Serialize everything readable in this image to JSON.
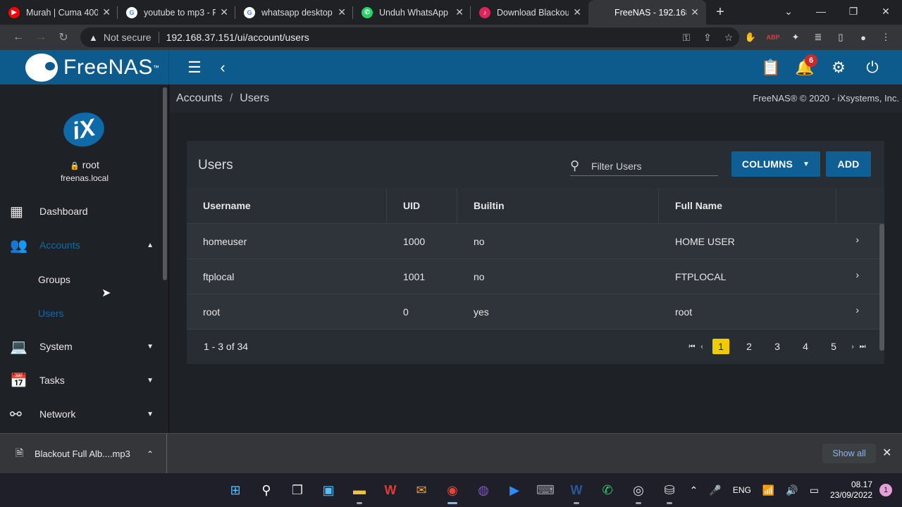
{
  "browser": {
    "tabs": [
      {
        "title": "Murah | Cuma 400",
        "favicon_color": "#ff0000",
        "favicon_glyph": "▶"
      },
      {
        "title": "youtube to mp3 - F",
        "favicon_color": "#4285f4",
        "favicon_glyph": "G"
      },
      {
        "title": "whatsapp desktop",
        "favicon_color": "#4285f4",
        "favicon_glyph": "G"
      },
      {
        "title": "Unduh WhatsApp",
        "favicon_color": "#25d366",
        "favicon_glyph": "✆"
      },
      {
        "title": "Download Blackout",
        "favicon_color": "#e0245e",
        "favicon_glyph": "♪"
      },
      {
        "title": "FreeNAS - 192.168",
        "favicon_color": "#35363a",
        "favicon_glyph": "",
        "active": true
      }
    ],
    "security_label": "Not secure",
    "url": "192.168.37.151/ui/account/users"
  },
  "freenas": {
    "brand": "FreeNAS",
    "notification_count": "6",
    "user": {
      "name": "root",
      "host": "freenas.local"
    },
    "nav": {
      "dashboard": "Dashboard",
      "accounts": "Accounts",
      "groups": "Groups",
      "users": "Users",
      "system": "System",
      "tasks": "Tasks",
      "network": "Network"
    },
    "breadcrumb": {
      "parent": "Accounts",
      "current": "Users"
    },
    "copyright": "FreeNAS® © 2020 - iXsystems, Inc.",
    "users_card": {
      "title": "Users",
      "filter_placeholder": "Filter Users",
      "columns_button": "COLUMNS",
      "add_button": "ADD",
      "headers": {
        "username": "Username",
        "uid": "UID",
        "builtin": "Builtin",
        "fullname": "Full Name"
      },
      "rows": [
        {
          "username": "homeuser",
          "uid": "1000",
          "builtin": "no",
          "fullname": "HOME USER"
        },
        {
          "username": "ftplocal",
          "uid": "1001",
          "builtin": "no",
          "fullname": "FTPLOCAL"
        },
        {
          "username": "root",
          "uid": "0",
          "builtin": "yes",
          "fullname": "root"
        }
      ],
      "range": "1 - 3 of 34",
      "pages": [
        "1",
        "2",
        "3",
        "4",
        "5"
      ],
      "current_page": "1"
    }
  },
  "downloads": {
    "file": "Blackout Full Alb....mp3",
    "show_all": "Show all"
  },
  "taskbar": {
    "lang": "ENG",
    "time": "08.17",
    "date": "23/09/2022",
    "notifications": "1"
  }
}
